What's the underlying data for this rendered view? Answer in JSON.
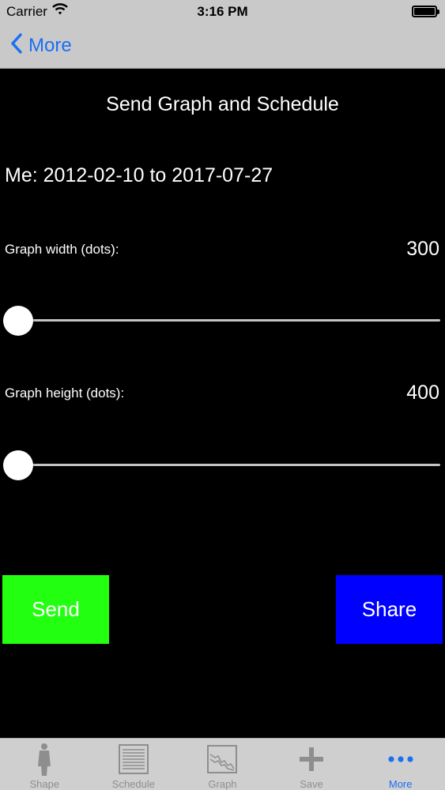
{
  "status_bar": {
    "carrier": "Carrier",
    "time": "3:16 PM"
  },
  "nav": {
    "back_label": "More"
  },
  "screen": {
    "title": "Send Graph and Schedule",
    "date_range": "Me: 2012-02-10 to 2017-07-27",
    "width_label": "Graph width (dots):",
    "width_value": "300",
    "width_slider_level": 0.0,
    "height_label": "Graph height (dots):",
    "height_value": "400",
    "height_slider_level": 0.0,
    "send_label": "Send",
    "share_label": "Share"
  },
  "tabs": [
    {
      "label": "Shape",
      "icon": "person-shape-icon",
      "active": false
    },
    {
      "label": "Schedule",
      "icon": "schedule-list-icon",
      "active": false
    },
    {
      "label": "Graph",
      "icon": "graph-chart-icon",
      "active": false
    },
    {
      "label": "Save",
      "icon": "plus-icon",
      "active": false
    },
    {
      "label": "More",
      "icon": "more-dots-icon",
      "active": true
    }
  ],
  "colors": {
    "accent": "#1a6ff5",
    "send_button": "#22ff11",
    "share_button": "#0000ff",
    "bars": "#c9c9c9",
    "background": "#000000"
  }
}
